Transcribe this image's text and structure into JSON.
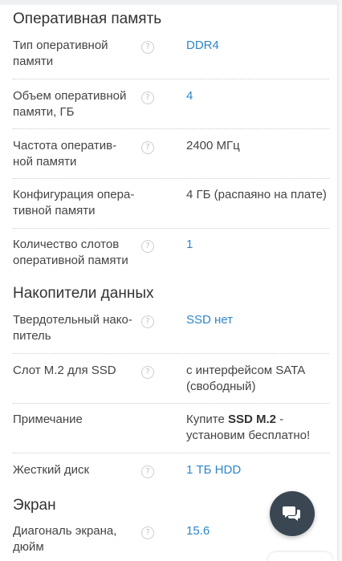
{
  "sections": {
    "ram": {
      "title": "Оперативная память"
    },
    "storage": {
      "title": "Накопители данных"
    },
    "screen": {
      "title": "Экран"
    }
  },
  "rows": {
    "ram_type": {
      "label_1": "Тип оперативной",
      "label_2": "памяти",
      "value": "DDR4"
    },
    "ram_size": {
      "label_1": "Объем оперативной",
      "label_2": "памяти, ГБ",
      "value": "4"
    },
    "ram_freq": {
      "label_1": "Частота оператив-",
      "label_2": "ной памяти",
      "value": "2400 МГц"
    },
    "ram_config": {
      "label_1": "Конфигурация опера-",
      "label_2": "тивной памяти",
      "value": "4 ГБ (распаяно на плате)"
    },
    "ram_slots": {
      "label_1": "Количество слотов",
      "label_2": "оперативной памяти",
      "value": "1"
    },
    "ssd": {
      "label_1": "Твердотельный нако-",
      "label_2": "питель",
      "value": "SSD нет"
    },
    "m2_slot": {
      "label_1": "Слот M.2 для SSD",
      "value_1": "с интерфейсом SATA",
      "value_2": "(свободный)"
    },
    "note": {
      "label_1": "Примечание",
      "value_pre": "Купите ",
      "value_bold": "SSD M.2",
      "value_post": " -",
      "value_2": "установим бесплатно!"
    },
    "hdd": {
      "label_1": "Жесткий диск",
      "value": "1 ТБ HDD"
    },
    "diagonal": {
      "label_1": "Диагональ экрана,",
      "label_2": "дюйм",
      "value": "15.6"
    }
  },
  "help_glyph": "?",
  "icons": {
    "help": "question-circle-icon",
    "chat": "chat-bubbles-icon"
  },
  "colors": {
    "link": "#2f86c9",
    "text": "#444444",
    "chat_button": "#3a4652"
  }
}
